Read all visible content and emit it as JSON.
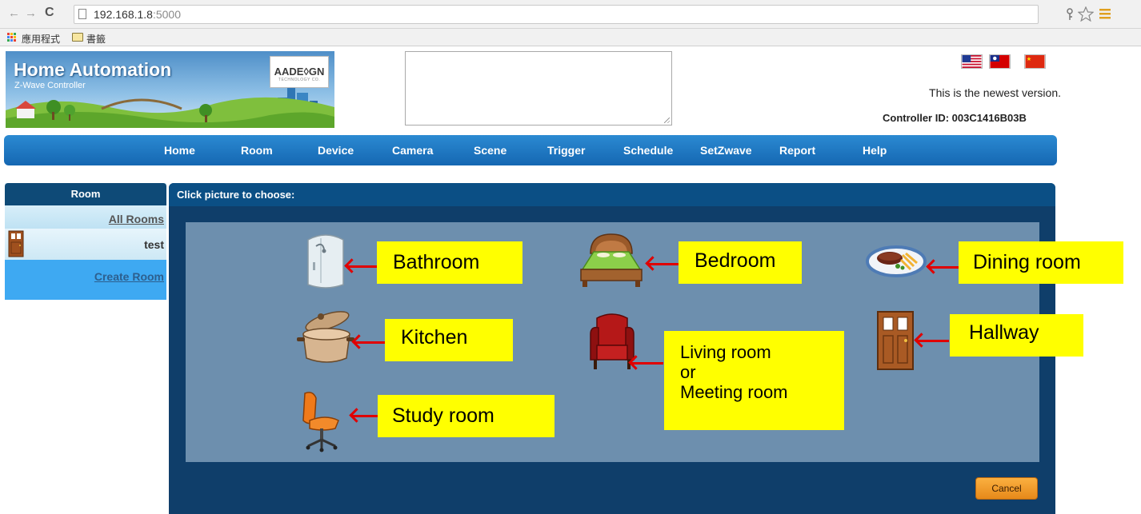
{
  "browser": {
    "back_glyph": "←",
    "forward_glyph": "→",
    "reload_glyph": "C",
    "url_host": "192.168.1.8",
    "url_port": ":5000",
    "bookmark_apps": "應用程式",
    "bookmark_folder": "書籤"
  },
  "header": {
    "banner_title": "Home Automation",
    "banner_subtitle": "Z-Wave Controller",
    "logo_text": "AADE◊GN",
    "logo_tagline": "TECHNOLOGY CO.",
    "version_text": "This is the newest version.",
    "controller_id": "Controller ID: 003C1416B03B"
  },
  "nav": {
    "items": [
      "Home",
      "Room",
      "Device",
      "Camera",
      "Scene",
      "Trigger",
      "Schedule",
      "SetZwave",
      "Report",
      "Help"
    ]
  },
  "room_panel": {
    "header": "Room",
    "all_rooms": "All Rooms",
    "rooms": [
      "test"
    ],
    "create_room": "Create Room"
  },
  "dialog": {
    "title": "Click picture to choose:",
    "cancel_label": "Cancel",
    "room_types": [
      {
        "icon": "shower-icon",
        "label": "Bathroom"
      },
      {
        "icon": "bed-icon",
        "label": "Bedroom"
      },
      {
        "icon": "dinner-plate-icon",
        "label": "Dining room"
      },
      {
        "icon": "cooking-pot-icon",
        "label": "Kitchen"
      },
      {
        "icon": "armchair-icon",
        "label_lines": [
          "Living room",
          "or",
          "Meeting room"
        ]
      },
      {
        "icon": "door-icon",
        "label": "Hallway"
      },
      {
        "icon": "office-chair-icon",
        "label": "Study room"
      }
    ]
  },
  "colors": {
    "nav_blue": "#1567b2",
    "dialog_navy": "#0f3e6a",
    "picture_area": "#6d8fae",
    "callout_yellow": "#ffff00",
    "arrow_red": "#e00000",
    "cancel_orange": "#f39c23"
  }
}
